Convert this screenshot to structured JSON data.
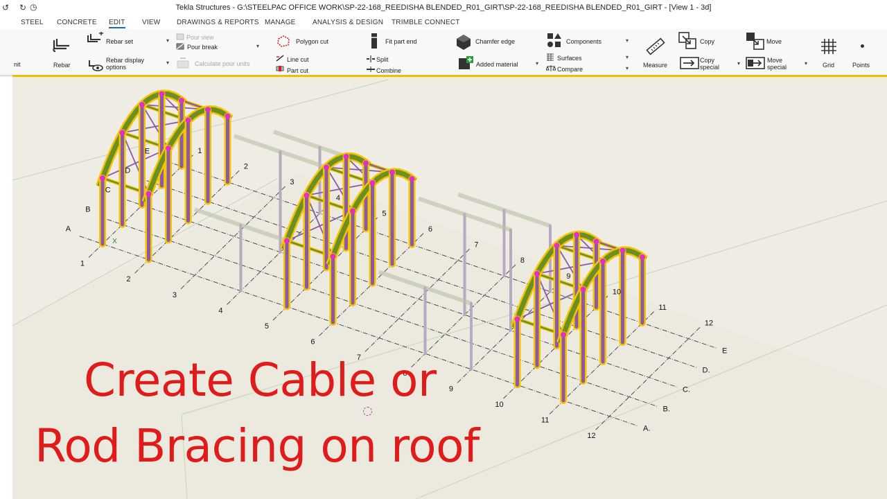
{
  "window": {
    "title": "Tekla Structures - G:\\STEELPAC OFFICE WORK\\SP-22-168_REEDISHA BLENDED_R01_GIRT\\SP-22-168_REEDISHA BLENDED_R01_GIRT  - [View 1 - 3d]"
  },
  "menu": {
    "tabs": [
      "STEEL",
      "CONCRETE",
      "EDIT",
      "VIEW",
      "DRAWINGS & REPORTS",
      "MANAGE",
      "ANALYSIS & DESIGN",
      "TRIMBLE CONNECT"
    ],
    "active_tab": "EDIT"
  },
  "ribbon": {
    "unit_label": "nit",
    "rebar_label": "Rebar",
    "rebar_set_label": "Rebar set",
    "rebar_display_line1": "Rebar display",
    "rebar_display_line2": "options",
    "pour_view_label": "Pour view",
    "pour_break_label": "Pour break",
    "calculate_pour_units_label": "Calculate pour units",
    "polygon_cut_label": "Polygon cut",
    "line_cut_label": "Line cut",
    "part_cut_label": "Part cut",
    "fit_part_end_label": "Fit part end",
    "split_label": "Split",
    "combine_label": "Combine",
    "chamfer_edge_label": "Chamfer edge",
    "added_material_label": "Added material",
    "components_label": "Components",
    "surfaces_label": "Surfaces",
    "compare_label": "Compare",
    "measure_label": "Measure",
    "copy_label": "Copy",
    "copy_special_line1": "Copy",
    "copy_special_line2": "special",
    "move_label": "Move",
    "move_special_line1": "Move",
    "move_special_line2": "special",
    "grid_label": "Grid",
    "points_label": "Points"
  },
  "model": {
    "grid_letters": [
      "A",
      "B",
      "C",
      "D",
      "E"
    ],
    "grid_numbers": [
      "1",
      "2",
      "3",
      "4",
      "5",
      "6",
      "7",
      "8",
      "9",
      "10",
      "11",
      "12"
    ],
    "front_grid_letters": [
      "A.",
      "B.",
      "C.",
      "D.",
      "E"
    ],
    "axis_label": "X",
    "colors": {
      "background": "#efece3",
      "rafter": "#6c8f24",
      "column": "#8a5aa8",
      "highlight": "#f5c400",
      "node": "#e030c8",
      "ghost": "#b9c0a8",
      "ghost_column": "#b8a8c0"
    }
  },
  "overlay": {
    "line1": "Create Cable or",
    "line2": "Rod Bracing on roof"
  }
}
